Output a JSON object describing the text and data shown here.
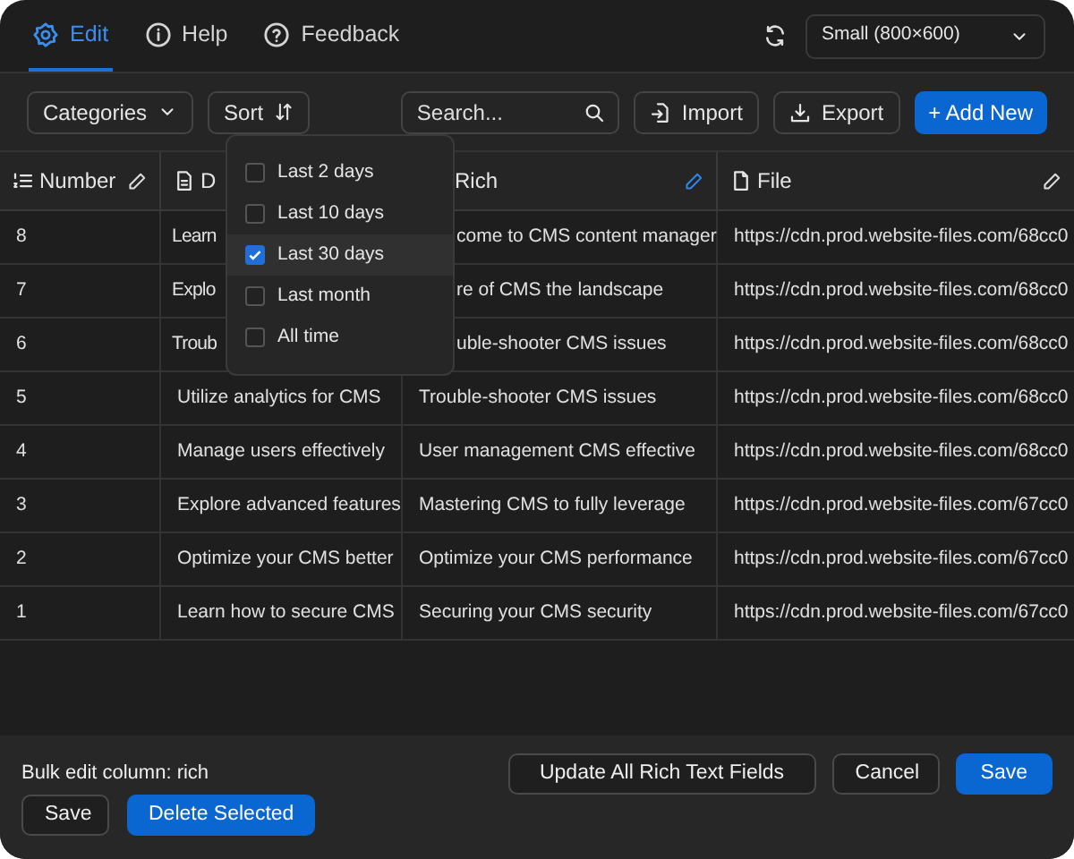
{
  "tabs": [
    {
      "label": "Edit",
      "selected": true
    },
    {
      "label": "Help",
      "selected": false
    },
    {
      "label": "Feedback",
      "selected": false
    }
  ],
  "size_select": {
    "value": "Small (800×600)"
  },
  "toolbar": {
    "categories": "Categories",
    "sort": "Sort",
    "search": {
      "placeholder": "Search..."
    },
    "import": "Import",
    "export": "Export",
    "add_new": "+ Add New"
  },
  "sort_menu": [
    {
      "label": "Last 2 days",
      "checked": false
    },
    {
      "label": "Last 10 days",
      "checked": false
    },
    {
      "label": "Last 30 days",
      "checked": true
    },
    {
      "label": "Last month",
      "checked": false
    },
    {
      "label": "All time",
      "checked": false
    }
  ],
  "table": {
    "columns": [
      {
        "label": "Number",
        "editing": false
      },
      {
        "label": "D"
      },
      {
        "label": "Rich",
        "editing": true
      },
      {
        "label": "File",
        "editing": false
      }
    ],
    "rows": [
      [
        "8",
        "Learn",
        "come to CMS content manager",
        "https://cdn.prod.website-files.com/68cc0"
      ],
      [
        "7",
        "Explo",
        "re of CMS the landscape",
        "https://cdn.prod.website-files.com/68cc0"
      ],
      [
        "6",
        "Troub",
        "uble-shooter CMS issues",
        "https://cdn.prod.website-files.com/68cc0"
      ],
      [
        "5",
        "Utilize analytics for CMS",
        "Trouble-shooter CMS issues",
        "https://cdn.prod.website-files.com/68cc0"
      ],
      [
        "4",
        "Manage  users effectively",
        "User management CMS effective",
        "https://cdn.prod.website-files.com/68cc0"
      ],
      [
        "3",
        "Explore advanced features",
        "Mastering CMS to fully leverage",
        "https://cdn.prod.website-files.com/67cc0"
      ],
      [
        "2",
        "Optimize your CMS better",
        "Optimize your CMS performance",
        "https://cdn.prod.website-files.com/67cc0"
      ],
      [
        "1",
        "Learn how to secure CMS",
        "Securing your CMS security",
        "https://cdn.prod.website-files.com/67cc0"
      ]
    ]
  },
  "bulk_edit": {
    "label": "Bulk edit column: rich",
    "update": "Update All Rich Text Fields",
    "cancel": "Cancel",
    "save": "Save"
  },
  "footer_buttons": {
    "save": "Save",
    "delete": "Delete Selected"
  }
}
